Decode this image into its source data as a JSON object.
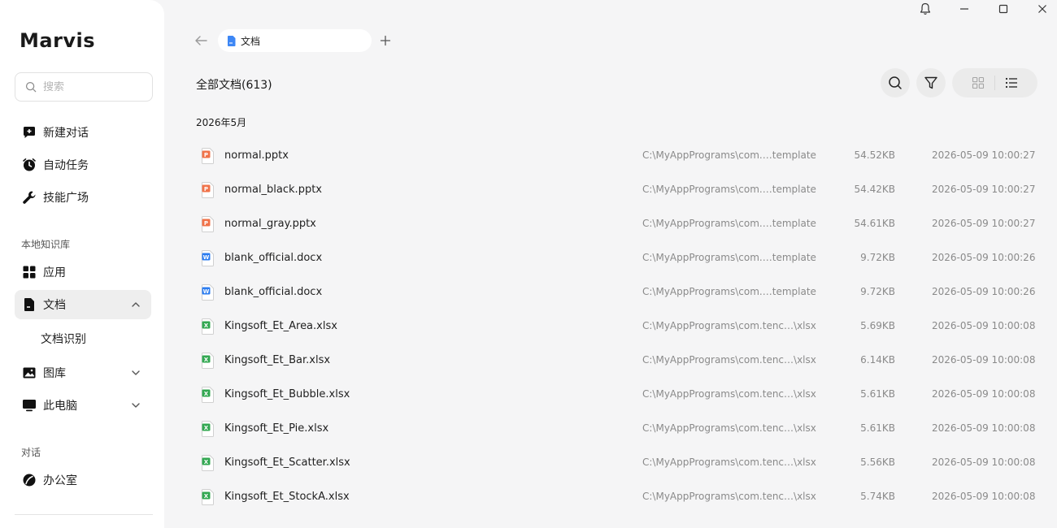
{
  "app": {
    "name": "Marvis"
  },
  "sidebar": {
    "search_placeholder": "搜索",
    "top_items": [
      {
        "label": "新建对话",
        "icon": "new-chat-icon"
      },
      {
        "label": "自动任务",
        "icon": "alarm-clock-icon"
      },
      {
        "label": "技能广场",
        "icon": "wrench-icon"
      }
    ],
    "kb_section": "本地知识库",
    "kb_items": [
      {
        "label": "应用",
        "icon": "apps-grid-icon"
      },
      {
        "label": "文档",
        "icon": "document-icon",
        "expanded": true
      },
      {
        "label": "图库",
        "icon": "image-icon"
      },
      {
        "label": "此电脑",
        "icon": "monitor-icon"
      }
    ],
    "doc_subitem": "文档识别",
    "chat_section": "对话",
    "chat_items": [
      {
        "label": "办公室",
        "icon": "leaf-icon"
      }
    ]
  },
  "tab": {
    "label": "文档"
  },
  "header": {
    "title": "全部文档(613)"
  },
  "group_label": "2026年5月",
  "colors": {
    "pptx": "#f0734a",
    "docx": "#2b7cf0",
    "xlsx": "#33a852"
  },
  "files": [
    {
      "name": "normal.pptx",
      "type": "pptx",
      "path": "C:\\MyAppPrograms\\com.…template",
      "size": "54.52KB",
      "date": "2026-05-09 10:00:27"
    },
    {
      "name": "normal_black.pptx",
      "type": "pptx",
      "path": "C:\\MyAppPrograms\\com.…template",
      "size": "54.42KB",
      "date": "2026-05-09 10:00:27"
    },
    {
      "name": "normal_gray.pptx",
      "type": "pptx",
      "path": "C:\\MyAppPrograms\\com.…template",
      "size": "54.61KB",
      "date": "2026-05-09 10:00:27"
    },
    {
      "name": "blank_official.docx",
      "type": "docx",
      "path": "C:\\MyAppPrograms\\com.…template",
      "size": "9.72KB",
      "date": "2026-05-09 10:00:26"
    },
    {
      "name": "blank_official.docx",
      "type": "docx",
      "path": "C:\\MyAppPrograms\\com.…template",
      "size": "9.72KB",
      "date": "2026-05-09 10:00:26"
    },
    {
      "name": "Kingsoft_Et_Area.xlsx",
      "type": "xlsx",
      "path": "C:\\MyAppPrograms\\com.tenc…\\xlsx",
      "size": "5.69KB",
      "date": "2026-05-09 10:00:08"
    },
    {
      "name": "Kingsoft_Et_Bar.xlsx",
      "type": "xlsx",
      "path": "C:\\MyAppPrograms\\com.tenc…\\xlsx",
      "size": "6.14KB",
      "date": "2026-05-09 10:00:08"
    },
    {
      "name": "Kingsoft_Et_Bubble.xlsx",
      "type": "xlsx",
      "path": "C:\\MyAppPrograms\\com.tenc…\\xlsx",
      "size": "5.61KB",
      "date": "2026-05-09 10:00:08"
    },
    {
      "name": "Kingsoft_Et_Pie.xlsx",
      "type": "xlsx",
      "path": "C:\\MyAppPrograms\\com.tenc…\\xlsx",
      "size": "5.61KB",
      "date": "2026-05-09 10:00:08"
    },
    {
      "name": "Kingsoft_Et_Scatter.xlsx",
      "type": "xlsx",
      "path": "C:\\MyAppPrograms\\com.tenc…\\xlsx",
      "size": "5.56KB",
      "date": "2026-05-09 10:00:08"
    },
    {
      "name": "Kingsoft_Et_StockA.xlsx",
      "type": "xlsx",
      "path": "C:\\MyAppPrograms\\com.tenc…\\xlsx",
      "size": "5.74KB",
      "date": "2026-05-09 10:00:08"
    }
  ]
}
